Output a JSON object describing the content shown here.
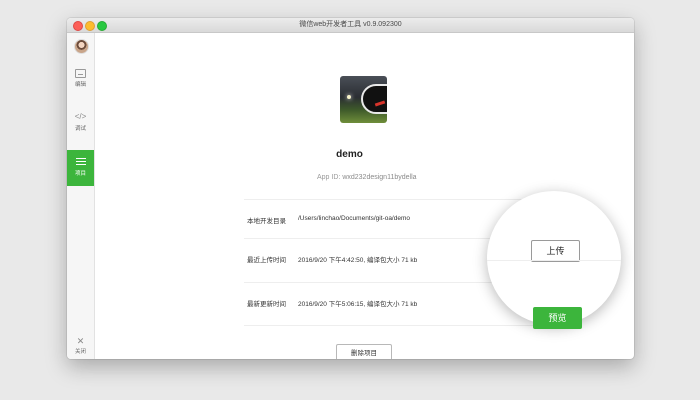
{
  "window": {
    "title": "微信web开发者工具 v0.9.092300"
  },
  "sidebar": {
    "items": [
      {
        "label": "编辑",
        "icon": "edit-icon"
      },
      {
        "label": "调试",
        "icon": "code-icon"
      },
      {
        "label": "项目",
        "icon": "menu-icon"
      }
    ],
    "close_label": "关闭",
    "active_color": "#3cb53c"
  },
  "project": {
    "name": "demo",
    "app_id_label": "App ID:",
    "app_id": "wxd232design11bydella"
  },
  "info_rows": [
    {
      "label": "本地开发目录",
      "value": "/Users/linchao/Documents/git-oa/demo"
    },
    {
      "label": "最近上传时间",
      "value": "2016/9/20 下午4:42:50, 编译包大小 71 kb"
    },
    {
      "label": "最新更新时间",
      "value": "2016/9/20 下午5:06:15, 编译包大小 71 kb"
    }
  ],
  "buttons": {
    "upload": "上传",
    "preview": "预览",
    "delete": "删除项目"
  }
}
